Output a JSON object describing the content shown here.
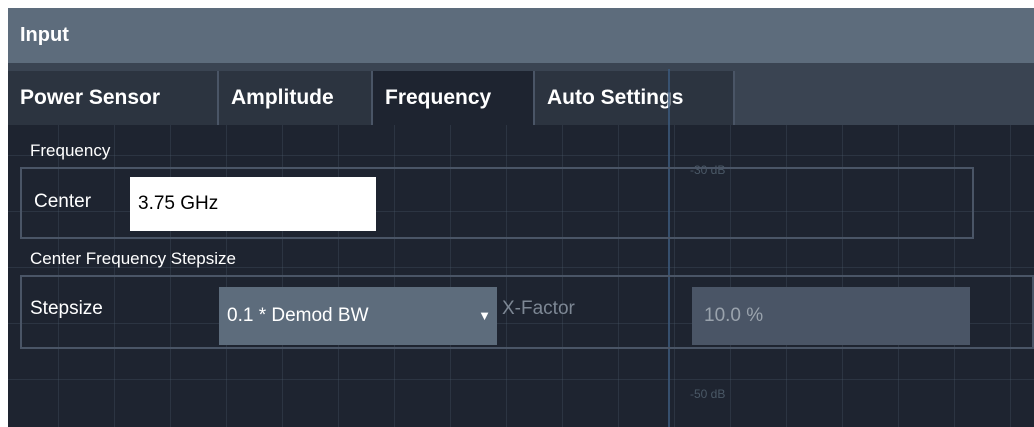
{
  "dialog": {
    "title": "Input"
  },
  "tabs": [
    {
      "label": "Power Sensor"
    },
    {
      "label": "Amplitude"
    },
    {
      "label": "Frequency"
    },
    {
      "label": "Auto Settings"
    }
  ],
  "frequency_section": {
    "heading": "Frequency",
    "center_label": "Center",
    "center_value": "3.75 GHz"
  },
  "stepsize_section": {
    "heading": "Center Frequency Stepsize",
    "stepsize_label": "Stepsize",
    "stepsize_value": "0.1 * Demod BW",
    "xfactor_label": "X-Factor",
    "xfactor_value": "10.0 %"
  },
  "background": {
    "db_labels": [
      "-30 dB",
      "-50 dB"
    ]
  }
}
